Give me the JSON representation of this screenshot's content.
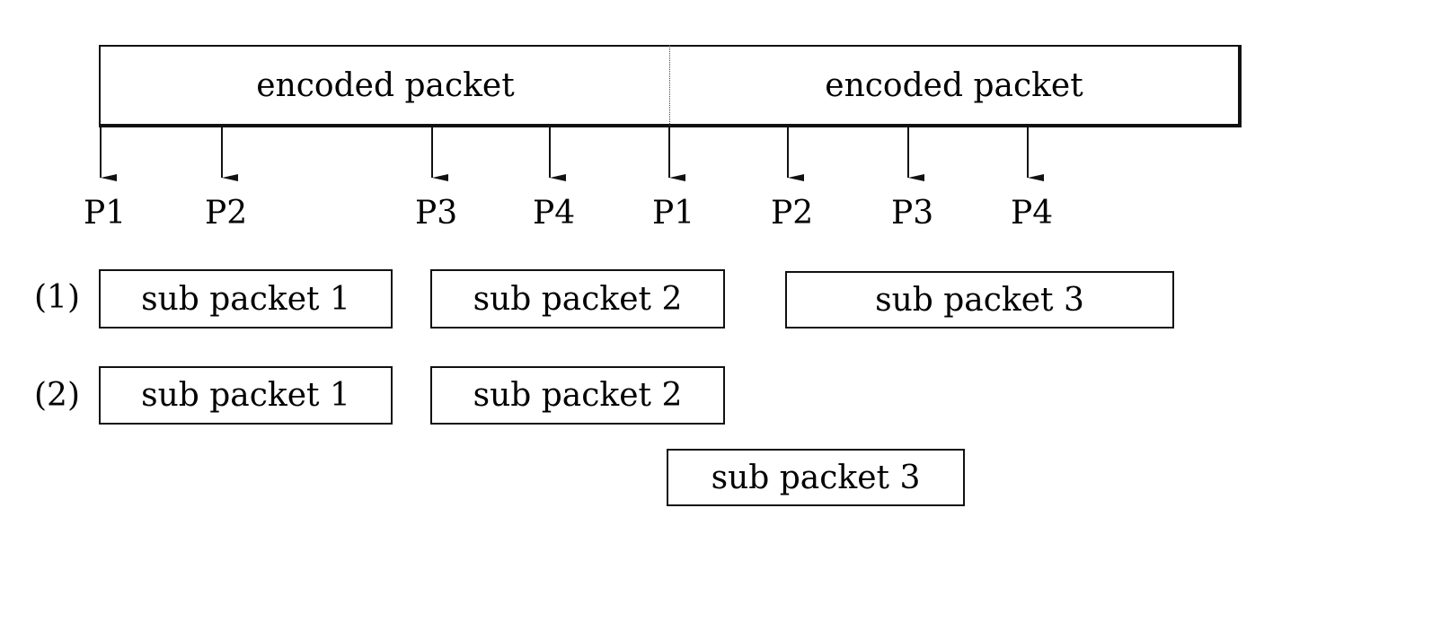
{
  "encoded_packets": [
    {
      "label": "encoded packet"
    },
    {
      "label": "encoded packet"
    }
  ],
  "position_markers": [
    "P1",
    "P2",
    "P3",
    "P4",
    "P1",
    "P2",
    "P3",
    "P4"
  ],
  "schemes": [
    {
      "label": "(1)",
      "sub_packets": [
        {
          "label": "sub packet 1",
          "from": "P1",
          "to": "P3"
        },
        {
          "label": "sub packet 2",
          "from": "P3",
          "to": "P2"
        },
        {
          "label": "sub packet 3",
          "from": "P2",
          "to": "end"
        }
      ]
    },
    {
      "label": "(2)",
      "sub_packets": [
        {
          "label": "sub packet 1",
          "from": "P1",
          "to": "P3"
        },
        {
          "label": "sub packet 2",
          "from": "P3",
          "to": "P1"
        },
        {
          "label": "sub packet 3",
          "from": "P1",
          "to": "P4"
        }
      ]
    }
  ]
}
